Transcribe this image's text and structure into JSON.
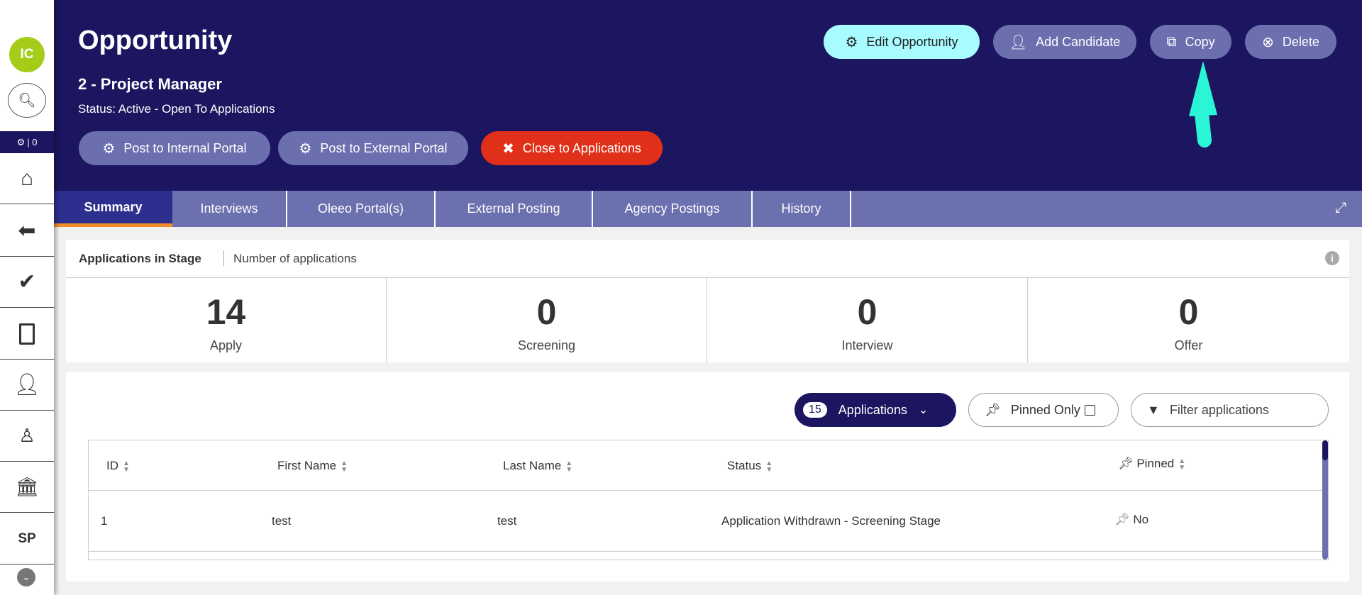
{
  "sidebar": {
    "avatar": "IC",
    "counter": "| 0",
    "user_initials": "SP",
    "items": [
      "home",
      "back",
      "tasks",
      "documents",
      "candidates",
      "search-candidates",
      "organisation"
    ]
  },
  "header": {
    "title": "Opportunity",
    "subtitle": "2 - Project Manager",
    "status": "Status: Active - Open To Applications",
    "actions": {
      "edit": "Edit Opportunity",
      "add_candidate": "Add Candidate",
      "copy": "Copy",
      "delete": "Delete"
    },
    "post_internal": "Post to Internal Portal",
    "post_external": "Post to External Portal",
    "close": "Close to Applications"
  },
  "tabs": [
    "Summary",
    "Interviews",
    "Oleeo Portal(s)",
    "External Posting",
    "Agency Postings",
    "History"
  ],
  "stage_card": {
    "title": "Applications in Stage",
    "subtitle": "Number of applications",
    "stats": [
      {
        "value": "14",
        "label": "Apply"
      },
      {
        "value": "0",
        "label": "Screening"
      },
      {
        "value": "0",
        "label": "Interview"
      },
      {
        "value": "0",
        "label": "Offer"
      }
    ]
  },
  "applications": {
    "count": "15",
    "label": "Applications",
    "pinned_only": "Pinned Only",
    "filter_placeholder": "Filter applications",
    "columns": [
      "ID",
      "First Name",
      "Last Name",
      "Status",
      "Pinned"
    ],
    "rows": [
      {
        "id": "1",
        "first": "test",
        "last": "test",
        "status": "Application Withdrawn - Screening Stage",
        "pinned": "No"
      }
    ]
  },
  "colors": {
    "header": "#1c1660",
    "accent": "#a8fcff",
    "danger": "#e1301a",
    "tab_active_border": "#f28c28",
    "annotation_arrow": "#2af5d5"
  }
}
